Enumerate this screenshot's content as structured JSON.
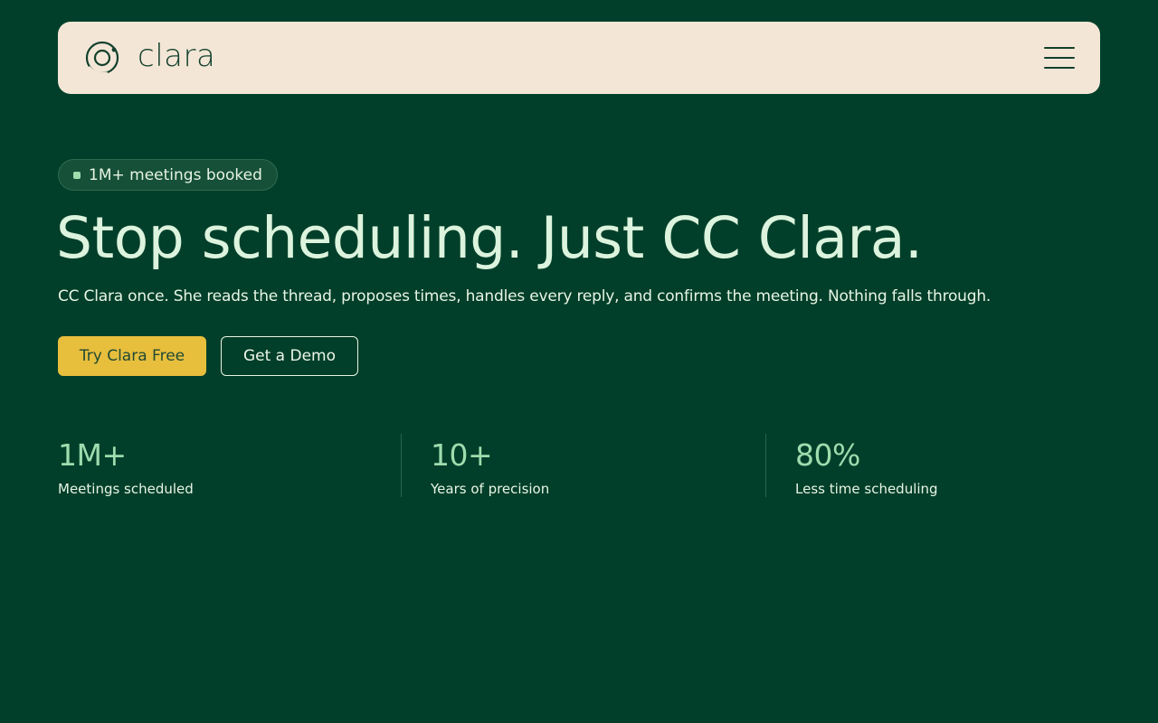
{
  "nav": {
    "brand_name": "clara",
    "logo_icon": "clara-orbit-icon",
    "menu_icon": "hamburger-menu-icon"
  },
  "hero": {
    "badge": "1M+ meetings booked",
    "title": "Stop scheduling. Just CC Clara.",
    "subtitle": "CC Clara once. She reads the thread, proposes times, handles every reply, and confirms the meeting. Nothing falls through.",
    "primary_cta": "Try Clara Free",
    "secondary_cta": "Get a Demo"
  },
  "stats": [
    {
      "value": "1M+",
      "label": "Meetings scheduled"
    },
    {
      "value": "10+",
      "label": "Years of precision"
    },
    {
      "value": "80%",
      "label": "Less time scheduling"
    }
  ],
  "colors": {
    "background": "#013f2a",
    "nav_background": "#f3e6d6",
    "accent_yellow": "#e8be3d",
    "accent_green": "#9fdcae",
    "text_light": "#e8f5e4"
  }
}
